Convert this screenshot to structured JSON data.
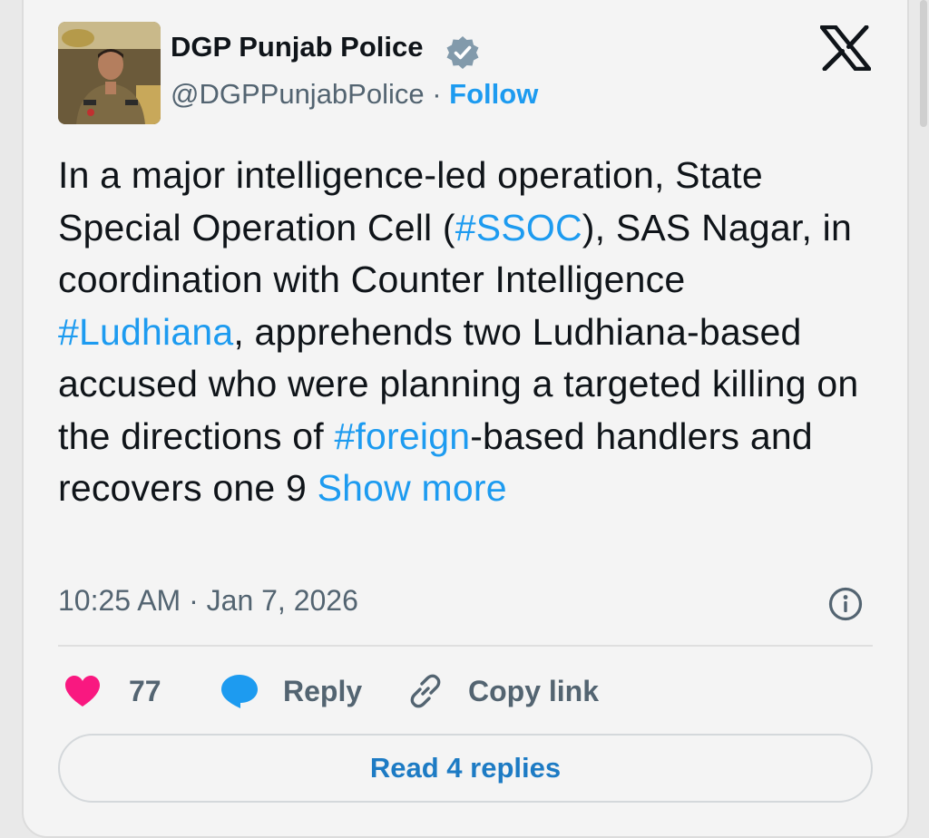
{
  "author": {
    "name": "DGP Punjab Police",
    "handle": "@DGPPunjabPolice",
    "separator": " · ",
    "follow_label": "Follow",
    "verified_icon": "verified-badge-icon"
  },
  "tweet": {
    "segments": [
      {
        "text": "In a major intelligence-led operation, State Special Operation Cell (",
        "type": "text"
      },
      {
        "text": "#SSOC",
        "type": "hashtag"
      },
      {
        "text": "), SAS Nagar, in coordination with Counter Intelligence ",
        "type": "text"
      },
      {
        "text": "#Ludhiana",
        "type": "hashtag"
      },
      {
        "text": ", apprehends two Ludhiana-based accused who were planning a targeted killing on the directions of ",
        "type": "text"
      },
      {
        "text": "#foreign",
        "type": "hashtag"
      },
      {
        "text": "-based handlers and recovers one 9 ",
        "type": "text"
      }
    ],
    "show_more_label": "Show more",
    "timestamp": "10:25 AM · Jan 7, 2026"
  },
  "actions": {
    "like_count": "77",
    "reply_label": "Reply",
    "copy_link_label": "Copy link"
  },
  "read_replies_label": "Read 4 replies",
  "colors": {
    "accent": "#1d9bf0",
    "heart": "#f91880",
    "text": "#0f1419",
    "muted": "#536471"
  }
}
